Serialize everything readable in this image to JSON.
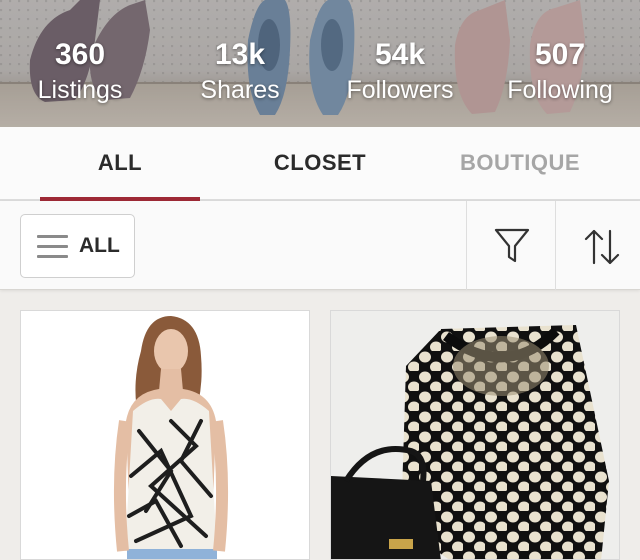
{
  "profile": {
    "stats": [
      {
        "value": "360",
        "label": "Listings"
      },
      {
        "value": "13k",
        "label": "Shares"
      },
      {
        "value": "54k",
        "label": "Followers"
      },
      {
        "value": "507",
        "label": "Following"
      }
    ]
  },
  "tabs": [
    {
      "label": "ALL",
      "active": true
    },
    {
      "label": "CLOSET",
      "active": false
    },
    {
      "label": "BOUTIQUE",
      "active": false
    }
  ],
  "toolbar": {
    "menu_label": "ALL",
    "menu_icon": "hamburger-icon",
    "filter_icon": "filter-funnel-icon",
    "sort_icon": "sort-arrows-icon"
  },
  "colors": {
    "accent": "#9e2a36",
    "inactive_tab": "#a6a6a6",
    "text": "#2b2b2b"
  },
  "listings": [
    {
      "image": "model-in-black-white-print-sleeveless-top"
    },
    {
      "image": "black-cream-honeycomb-sweater-with-black-bag"
    }
  ]
}
